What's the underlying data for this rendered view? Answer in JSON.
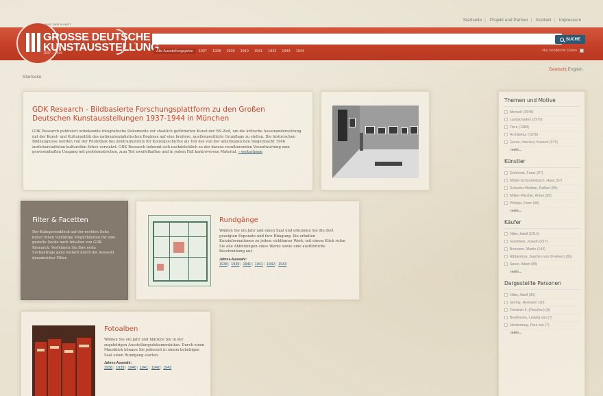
{
  "top_links": [
    "Startseite",
    "Projekt und Partner",
    "Kontakt",
    "Impressum"
  ],
  "logo": {
    "small_text": "HAUS DER KUNST",
    "line1": "GROSSE DEUTSCHE",
    "line2": "KUNSTAUSSTELLUNG",
    "years": "1937 – 1944",
    "arrow": "»"
  },
  "search": {
    "value": "",
    "placeholder": "",
    "button_label": "SUCHE"
  },
  "years_nav": [
    "Alle Ausstellungsjahre",
    "1937",
    "1938",
    "1939",
    "1940",
    "1941",
    "1942",
    "1943",
    "1944"
  ],
  "only_images_label": "Nur bebilderte Daten",
  "language": {
    "de": "Deutsch",
    "sep": "|",
    "en": "English"
  },
  "breadcrumb": "Startseite",
  "intro": {
    "title": "GDK Research - Bildbasierte Forschungsplattform zu den Großen Deutschen Kunstausstellungen 1937-1944 in München",
    "text": "GDK Research publiziert unbekannte fotografische Dokumente zur staatlich geförderten Kunst der NS-Zeit, um die kritische Auseinandersetzung mit der Kunst- und Kulturpolitik des nationalsozialistischen Regimes auf eine breitere, quellengestützte Grundlage zu stellen. Die historischen Bildzeugnisse werden von der Photothek des Zentralinstituts für Kunstgeschichte als Teil des von der amerikanischen Siegermacht 1946 zurückerstatteten kulturellen Erbes verwahrt. GDK Research bekennt sich nachdrücklich zu der daraus resultierenden Verantwortung zum gewissenhaften Umgang mit problematischen, zum Teil zweifelhaften und in jedem Fall kontroversen Material.",
    "more_label": "› weiterlesen"
  },
  "filter": {
    "title": "Filter & Facetten",
    "text": "Der Kategorienblock auf der rechten Seite bietet Ihnen vielfältige Möglichkeiten für eine gezielte Suche nach Inhalten von GDK-Research. Verfeinern Sie Ihre erste Suchanfrage ganz einfach durch die Auswahl dynamischer Filter."
  },
  "rundgaenge": {
    "title": "Rundgänge",
    "text": "Wählen Sie ein Jahr und einen Saal und erkunden Sie die dort gezeigten Exponate und ihre Hängung. Sie erhalten Kurzinformationen zu jedem sichtbaren Werk, mit einem Klick rufen Sie alle Abbildungen eines Werks sowie eine ausführliche Beschreibung auf.",
    "year_label": "Jahres-Auswahl:",
    "years": [
      "1938",
      "1939",
      "1940",
      "1941",
      "1942",
      "1943"
    ]
  },
  "fotoalben": {
    "title": "Fotoalben",
    "text": "Wählen Sie ein Jahr und blättern Sie in der zugehörigen Ausstellungsdokumentation. Durch einen Mausklick können Sie jederzeit in einem beliebigen Saal einen Rundgang starten.",
    "year_label": "Jahres-Auswahl:",
    "years": [
      "1938",
      "1939",
      "1940",
      "1941",
      "1942",
      "1943"
    ]
  },
  "sidebar": {
    "sections": [
      {
        "title": "Themen und Motive",
        "items": [
          "Mensch (3645)",
          "Landschaften (2979)",
          "Tiere (1383)",
          "Architektur (1070)",
          "Genre, Interieur, Kostüm (976)"
        ],
        "more": "mehr..."
      },
      {
        "title": "Künstler",
        "items": [
          "Eichhorst, Franz (97)",
          "Müller-Schnuttenbach, Hans (57)",
          "Schuster-Woldan, Raffael (55)",
          "Müller-Wischin, Anton (50)",
          "Philippi, Peter (48)"
        ],
        "more": "mehr..."
      },
      {
        "title": "Käufer",
        "items": [
          "Hitler, Adolf (1314)",
          "Goebbels, Joseph (217)",
          "Bormann, Martin (144)",
          "Ribbentrop, Joachim von (Freiherr) (91)",
          "Speer, Albert (85)"
        ],
        "more": "mehr..."
      },
      {
        "title": "Dargestellte Personen",
        "items": [
          "Hitler, Adolf (36)",
          "Göring, Hermann (10)",
          "Friedrich II. (Preußen) (9)",
          "Beethoven, Ludwig van (7)",
          "Hindenburg, Paul von (7)"
        ],
        "more": "mehr..."
      }
    ]
  },
  "colors": {
    "brand_red": "#c8462c",
    "link_blue": "#2c5a74",
    "filter_bg": "#847a6e"
  }
}
